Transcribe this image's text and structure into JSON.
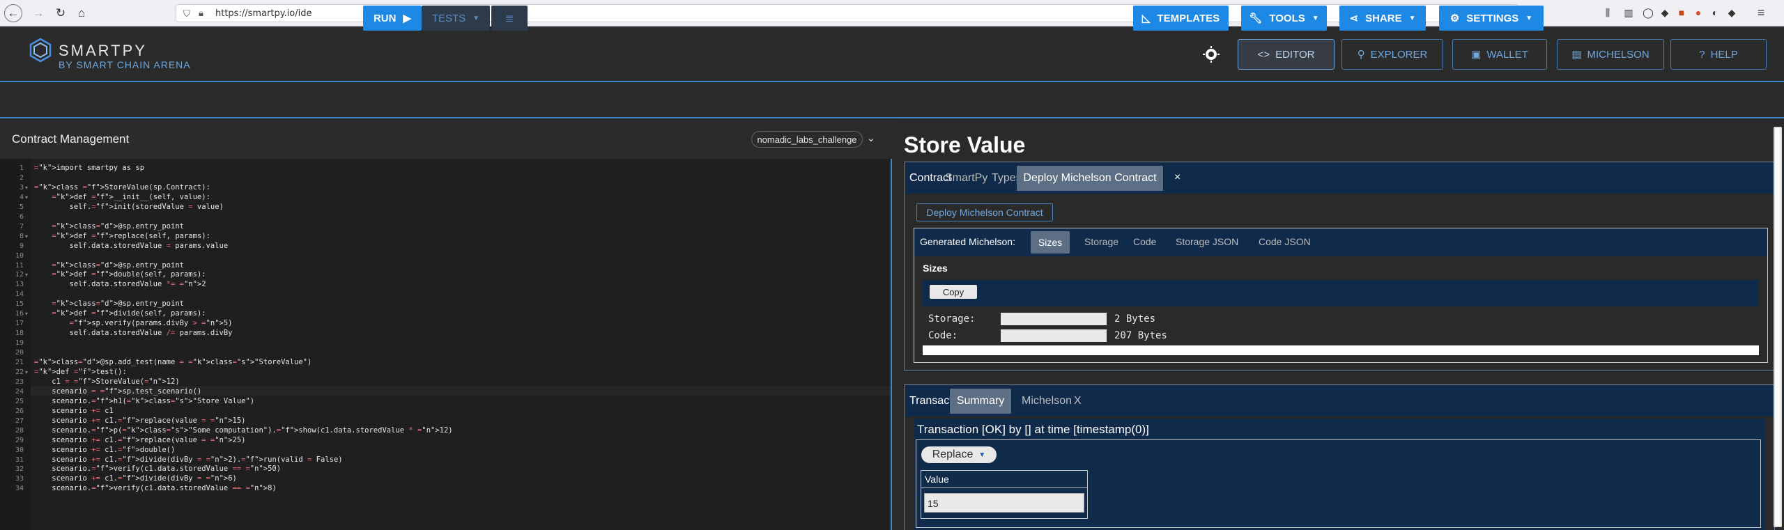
{
  "browser": {
    "url": "https://smartpy.io/ide"
  },
  "header": {
    "logo_text": "SMARTPY",
    "logo_sub": "BY SMART CHAIN ARENA",
    "nav": [
      {
        "label": "EDITOR"
      },
      {
        "label": "EXPLORER"
      },
      {
        "label": "WALLET"
      },
      {
        "label": "MICHELSON"
      },
      {
        "label": "HELP"
      }
    ]
  },
  "toolbar": {
    "run": "RUN",
    "tests": "TESTS",
    "templates": "TEMPLATES",
    "tools": "TOOLS",
    "share": "SHARE",
    "settings": "SETTINGS"
  },
  "editor_pane": {
    "title": "Contract Management",
    "contract_select": "nomadic_labs_challenge"
  },
  "code_lines": [
    "import smartpy as sp",
    "",
    "class StoreValue(sp.Contract):",
    "    def __init__(self, value):",
    "        self.init(storedValue = value)",
    "",
    "    @sp.entry_point",
    "    def replace(self, params):",
    "        self.data.storedValue = params.value",
    "",
    "    @sp.entry_point",
    "    def double(self, params):",
    "        self.data.storedValue *= 2",
    "",
    "    @sp.entry_point",
    "    def divide(self, params):",
    "        sp.verify(params.divBy > 5)",
    "        self.data.storedValue /= params.divBy",
    "",
    "",
    "@sp.add_test(name = \"StoreValue\")",
    "def test():",
    "    c1 = StoreValue(12)",
    "    scenario = sp.test_scenario()",
    "    scenario.h1(\"Store Value\")",
    "    scenario += c1",
    "    scenario += c1.replace(value = 15)",
    "    scenario.p(\"Some computation\").show(c1.data.storedValue * 12)",
    "    scenario += c1.replace(value = 25)",
    "    scenario += c1.double()",
    "    scenario += c1.divide(divBy = 2).run(valid = False)",
    "    scenario.verify(c1.data.storedValue == 50)",
    "    scenario += c1.divide(divBy = 6)",
    "    scenario.verify(c1.data.storedValue == 8)"
  ],
  "output": {
    "title": "Store Value",
    "contract_tabs": [
      "Contract",
      "SmartPy",
      "Types",
      "Deploy Michelson Contract",
      "×"
    ],
    "deploy_button": "Deploy Michelson Contract",
    "generated_label": "Generated Michelson:",
    "gen_tabs": [
      "Sizes",
      "Storage",
      "Code",
      "Storage JSON",
      "Code JSON"
    ],
    "sizes_title": "Sizes",
    "copy_button": "Copy",
    "storage_label": "Storage:",
    "storage_value": "2 Bytes",
    "code_label": "Code:",
    "code_value": "207 Bytes",
    "tx_tabs": [
      "Transaction",
      "Summary",
      "Michelson",
      "X"
    ],
    "tx_title": "Transaction [OK] by [] at time [timestamp(0)]",
    "entry_select": "Replace",
    "param_label": "Value",
    "param_value": "15"
  }
}
